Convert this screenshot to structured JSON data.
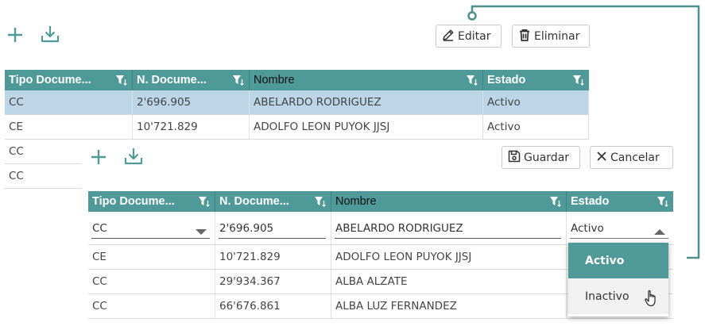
{
  "colors": {
    "accent": "#4f9a99",
    "selected_row": "#bcd6e8",
    "connector": "#4f8f8e"
  },
  "back_toolbar": {
    "add_icon": "plus-icon",
    "download_icon": "download-icon",
    "edit_label": "Editar",
    "delete_label": "Eliminar"
  },
  "back_grid": {
    "columns": [
      "Tipo Docume...",
      "N. Docume...",
      "Nombre",
      "Estado"
    ],
    "rows": [
      [
        "CC",
        "2'696.905",
        "ABELARDO RODRIGUEZ",
        "Activo"
      ],
      [
        "CE",
        "10'721.829",
        "ADOLFO LEON PUYOK JJSJ",
        "Activo"
      ],
      [
        "CC",
        "",
        "",
        ""
      ],
      [
        "CC",
        "",
        "",
        ""
      ]
    ]
  },
  "front_toolbar": {
    "add_icon": "plus-icon",
    "download_icon": "download-icon",
    "save_label": "Guardar",
    "cancel_label": "Cancelar"
  },
  "front_grid": {
    "columns": [
      "Tipo Docume...",
      "N. Docume...",
      "Nombre",
      "Estado"
    ],
    "edit_row": {
      "tipo": "CC",
      "numero": "2'696.905",
      "nombre": "ABELARDO RODRIGUEZ",
      "estado": "Activo"
    },
    "rows": [
      [
        "CE",
        "10'721.829",
        "ADOLFO LEON PUYOK JJSJ",
        ""
      ],
      [
        "CC",
        "29'934.367",
        "ALBA ALZATE",
        ""
      ],
      [
        "CC",
        "66'676.861",
        "ALBA LUZ FERNANDEZ",
        ""
      ]
    ]
  },
  "estado_dropdown": {
    "options": [
      "Activo",
      "Inactivo"
    ],
    "selected": "Activo"
  }
}
